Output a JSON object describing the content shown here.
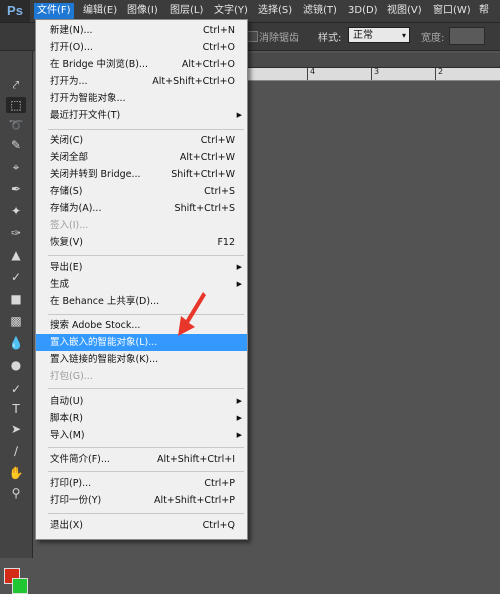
{
  "app": {
    "logo": "Ps"
  },
  "menubar": {
    "items": [
      {
        "label": "文件(F)"
      },
      {
        "label": "编辑(E)"
      },
      {
        "label": "图像(I)"
      },
      {
        "label": "图层(L)"
      },
      {
        "label": "文字(Y)"
      },
      {
        "label": "选择(S)"
      },
      {
        "label": "滤镜(T)"
      },
      {
        "label": "3D(D)"
      },
      {
        "label": "视图(V)"
      },
      {
        "label": "窗口(W)"
      },
      {
        "label": "帮"
      }
    ]
  },
  "options": {
    "anti_alias_label": "消除锯齿",
    "style_label": "样式:",
    "style_value": "正常",
    "width_label": "宽度:"
  },
  "ruler": {
    "labels": [
      "4",
      "3",
      "2"
    ]
  },
  "file_menu": {
    "items": [
      {
        "label": "新建(N)...",
        "shortcut": "Ctrl+N"
      },
      {
        "label": "打开(O)...",
        "shortcut": "Ctrl+O"
      },
      {
        "label": "在 Bridge 中浏览(B)...",
        "shortcut": "Alt+Ctrl+O"
      },
      {
        "label": "打开为...",
        "shortcut": "Alt+Shift+Ctrl+O"
      },
      {
        "label": "打开为智能对象...",
        "shortcut": ""
      },
      {
        "label": "最近打开文件(T)",
        "shortcut": "",
        "submenu": true
      },
      {
        "label": "关闭(C)",
        "shortcut": "Ctrl+W"
      },
      {
        "label": "关闭全部",
        "shortcut": "Alt+Ctrl+W"
      },
      {
        "label": "关闭并转到 Bridge...",
        "shortcut": "Shift+Ctrl+W"
      },
      {
        "label": "存储(S)",
        "shortcut": "Ctrl+S"
      },
      {
        "label": "存储为(A)...",
        "shortcut": "Shift+Ctrl+S"
      },
      {
        "label": "签入(I)...",
        "shortcut": "",
        "disabled": true
      },
      {
        "label": "恢复(V)",
        "shortcut": "F12"
      },
      {
        "label": "导出(E)",
        "shortcut": "",
        "submenu": true
      },
      {
        "label": "生成",
        "shortcut": "",
        "submenu": true
      },
      {
        "label": "在 Behance 上共享(D)...",
        "shortcut": ""
      },
      {
        "label": "搜索 Adobe Stock...",
        "shortcut": ""
      },
      {
        "label": "置入嵌入的智能对象(L)...",
        "shortcut": "",
        "highlighted": true
      },
      {
        "label": "置入链接的智能对象(K)...",
        "shortcut": ""
      },
      {
        "label": "打包(G)...",
        "shortcut": "",
        "disabled": true
      },
      {
        "label": "自动(U)",
        "shortcut": "",
        "submenu": true
      },
      {
        "label": "脚本(R)",
        "shortcut": "",
        "submenu": true
      },
      {
        "label": "导入(M)",
        "shortcut": "",
        "submenu": true
      },
      {
        "label": "文件简介(F)...",
        "shortcut": "Alt+Shift+Ctrl+I"
      },
      {
        "label": "打印(P)...",
        "shortcut": "Ctrl+P"
      },
      {
        "label": "打印一份(Y)",
        "shortcut": "Alt+Shift+Ctrl+P"
      },
      {
        "label": "退出(X)",
        "shortcut": "Ctrl+Q"
      }
    ]
  },
  "colors": {
    "foreground": "#d42b18",
    "background": "#21c633",
    "highlight": "#3399ff",
    "arrow": "#e8362a"
  }
}
